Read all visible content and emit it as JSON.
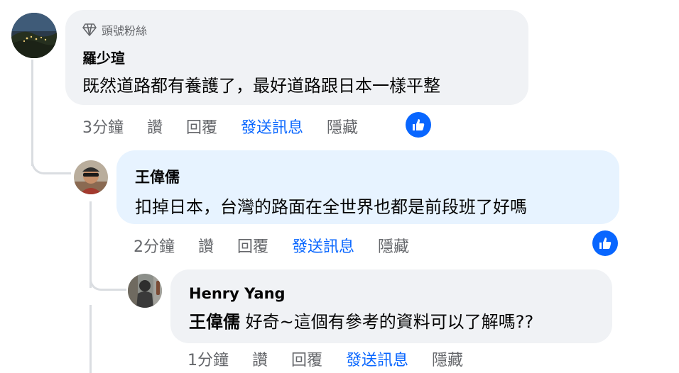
{
  "comments": [
    {
      "badge": "頭號粉絲",
      "author": "羅少瑄",
      "text": "既然道路都有養護了，最好道路跟日本一樣平整",
      "time": "3分鐘",
      "actions": {
        "like": "讚",
        "reply": "回覆",
        "send_message": "發送訊息",
        "hide": "隱藏"
      },
      "reaction": "like-icon"
    },
    {
      "author": "王偉儒",
      "text": "扣掉日本，台灣的路面在全世界也都是前段班了好嗎",
      "time": "2分鐘",
      "actions": {
        "like": "讚",
        "reply": "回覆",
        "send_message": "發送訊息",
        "hide": "隱藏"
      },
      "reaction": "like-icon"
    },
    {
      "author": "Henry Yang",
      "mention": "王偉儒",
      "text": " 好奇~這個有參考的資料可以了解嗎??",
      "time": "1分鐘",
      "actions": {
        "like": "讚",
        "reply": "回覆",
        "send_message": "發送訊息",
        "hide": "隱藏"
      }
    }
  ],
  "colors": {
    "bubble_default": "#f0f2f5",
    "bubble_highlight": "#e7f3ff",
    "link_blue": "#0866ff",
    "muted_text": "#65676b",
    "thread_line": "#dadde1"
  }
}
